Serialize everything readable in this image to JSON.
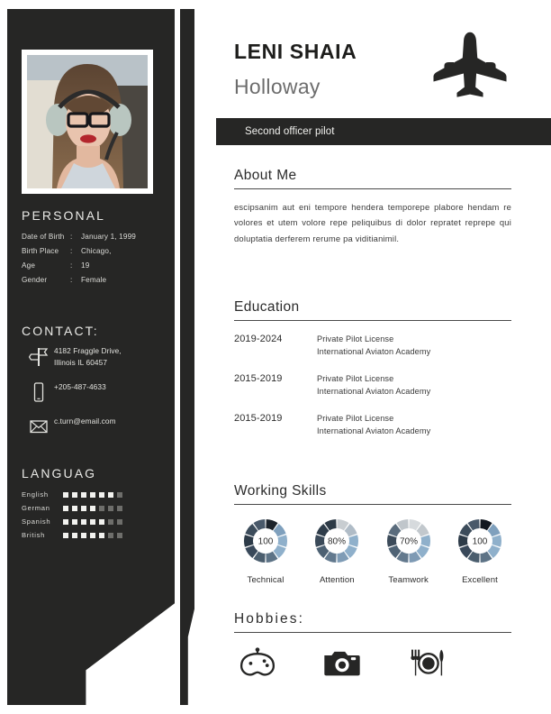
{
  "header": {
    "first_name": "LENI SHAIA",
    "last_name": "Holloway",
    "role": "Second officer pilot",
    "plane_icon": "airplane-icon"
  },
  "sidebar": {
    "personal": {
      "title": "PERSONAL",
      "rows": [
        {
          "label": "Date of Birth",
          "colon": ":",
          "value": "January 1, 1999"
        },
        {
          "label": "Birth Place",
          "colon": ":",
          "value": "Chicago,"
        },
        {
          "label": "Age",
          "colon": ":",
          "value": "19"
        },
        {
          "label": "Gender",
          "colon": ":",
          "value": "Female"
        }
      ]
    },
    "contact": {
      "title": "CONTACT:",
      "rows": [
        {
          "icon": "signpost-icon",
          "text": "4182 Fraggle Drive,\nIllinois IL 60457"
        },
        {
          "icon": "mobile-phone-icon",
          "text": "+205-487-4633"
        },
        {
          "icon": "envelope-icon",
          "text": "c.turn@email.com"
        }
      ]
    },
    "language": {
      "title": "LANGUAG",
      "total": 7,
      "rows": [
        {
          "name": "English",
          "filled": 6
        },
        {
          "name": "German",
          "filled": 4
        },
        {
          "name": "Spanish",
          "filled": 5
        },
        {
          "name": "British",
          "filled": 5
        }
      ]
    },
    "photo_alt": "profile-photo"
  },
  "about": {
    "title": "About  Me",
    "text": "escipsanim aut eni tempore hendera temporepe plabore hendam re volores et utem volore repe peliquibus di dolor repratet reprepe qui doluptatia derferem rerume pa viditianimil."
  },
  "education": {
    "title": "Education",
    "items": [
      {
        "year": "2019-2024",
        "line1": "Private  Pilot  License",
        "line2": "International  Aviaton  Academy"
      },
      {
        "year": "2015-2019",
        "line1": "Private  Pilot  License",
        "line2": "International  Aviaton  Academy"
      },
      {
        "year": "2015-2019",
        "line1": "Private  Pilot  License",
        "line2": "International  Aviaton  Academy"
      }
    ]
  },
  "skills": {
    "title": "Working  Skills",
    "items": [
      {
        "label": "Technical",
        "value": "100"
      },
      {
        "label": "Attention",
        "value": "80%"
      },
      {
        "label": "Teamwork",
        "value": "70%"
      },
      {
        "label": "Excellent",
        "value": "100"
      }
    ]
  },
  "hobbies": {
    "title": "Hobbies:",
    "icons": [
      "game-controller-icon",
      "camera-icon",
      "dining-icon"
    ]
  },
  "chart_data": {
    "type": "pie",
    "title": "Working  Skills",
    "categories": [
      "Technical",
      "Attention",
      "Teamwork",
      "Excellent"
    ],
    "values": [
      100,
      80,
      70,
      100
    ],
    "segments_per_donut": 10,
    "segment_colors": {
      "Technical": [
        "#1c232b",
        "#7fa0bd",
        "#8fb0cb",
        "#8fb0cb",
        "#5d7386",
        "#4b5e6e",
        "#39495a",
        "#2d3b48",
        "#3c4c5b",
        "#49596a"
      ],
      "Attention": [
        "#c8cdd1",
        "#b0bcc7",
        "#8fb0cb",
        "#8fb0cb",
        "#7f9cb6",
        "#62798e",
        "#4d6173",
        "#3b4a59",
        "#2f3d4a",
        "#2e3b47"
      ],
      "Teamwork": [
        "#d6dadd",
        "#c2c8cd",
        "#8fb0cb",
        "#8fb0cb",
        "#7e9ab4",
        "#63798d",
        "#4f6375",
        "#3c4b5a",
        "#5a6c7d",
        "#c0c6cb"
      ],
      "Excellent": [
        "#121820",
        "#7fa0bd",
        "#8fb0cb",
        "#8fb0cb",
        "#5d7386",
        "#4b5e6e",
        "#39495a",
        "#2d3b48",
        "#3c4c5b",
        "#49596a"
      ]
    },
    "ylabel": "",
    "xlabel": "",
    "legend": "none"
  },
  "colors": {
    "panel_dark": "#262625",
    "text_light": "#e9e9e6",
    "text_dark": "#2b2b2b",
    "accent_blue": "#8fb0cb",
    "page_bg": "#ffffff"
  }
}
